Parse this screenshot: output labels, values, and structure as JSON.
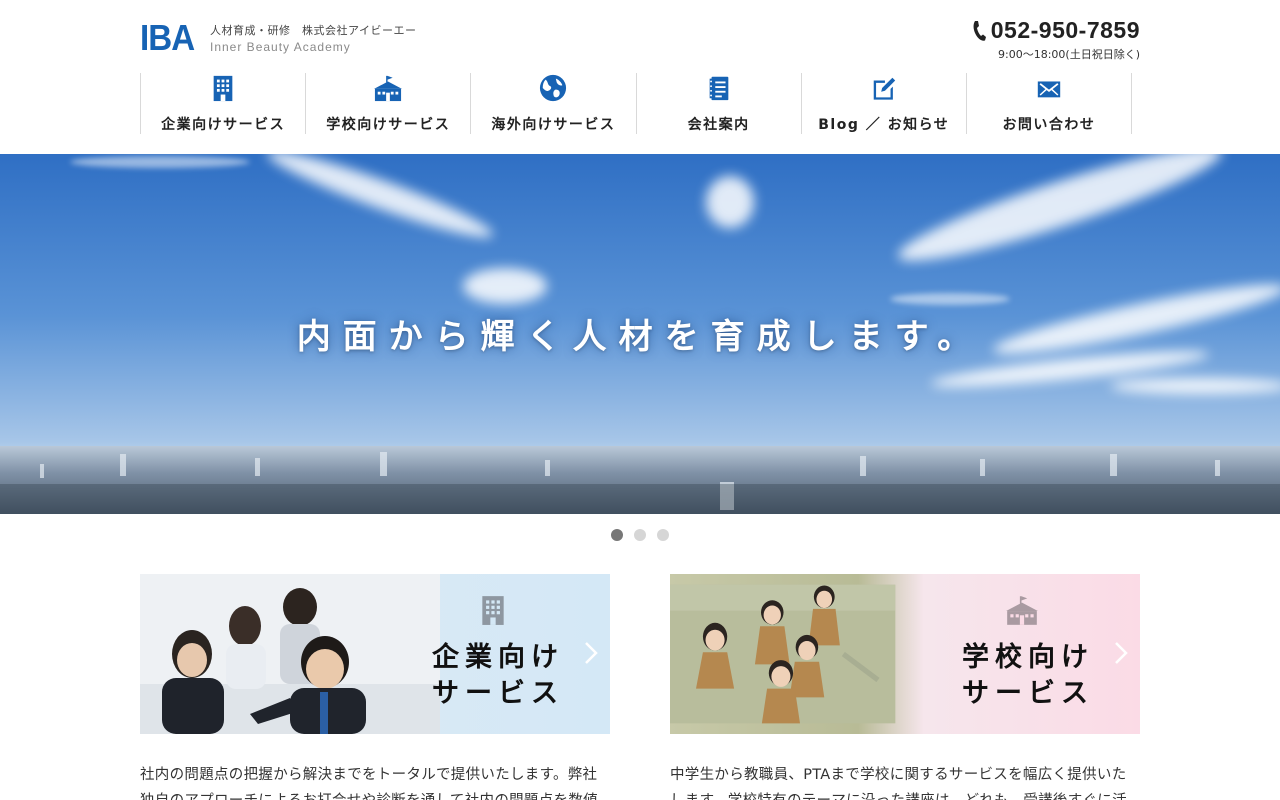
{
  "header": {
    "logo": "IBA",
    "tagline": "人材育成・研修　株式会社アイビーエー",
    "subname": "Inner Beauty Academy",
    "phone_icon": "phone-icon",
    "phone": "052-950-7859",
    "hours": "9:00〜18:00(土日祝日除く)"
  },
  "nav": {
    "items": [
      {
        "label": "企業向けサービス",
        "icon": "building-icon"
      },
      {
        "label": "学校向けサービス",
        "icon": "school-icon"
      },
      {
        "label": "海外向けサービス",
        "icon": "globe-icon"
      },
      {
        "label": "会社案内",
        "icon": "document-icon"
      },
      {
        "label": "Blog ／ お知らせ",
        "icon": "edit-icon"
      },
      {
        "label": "お問い合わせ",
        "icon": "mail-icon"
      }
    ]
  },
  "hero": {
    "copy": "内面から輝く人材を育成します。"
  },
  "slider": {
    "count": 3,
    "active": 1
  },
  "cards": {
    "corporate": {
      "title_line1": "企業向け",
      "title_line2": "サービス",
      "icon": "building-icon",
      "description": "社内の問題点の把握から解決までをトータルで提供いたします。弊社独自のアプローチによるお打合せや診断を通して社内の問題点を数値"
    },
    "school": {
      "title_line1": "学校向け",
      "title_line2": "サービス",
      "icon": "school-icon",
      "description": "中学生から教職員、PTAまで学校に関するサービスを幅広く提供いたします。学校特有のテーマに沿った講座は、どれも、受講後すぐに活"
    }
  },
  "colors": {
    "brand": "#1763b4",
    "nav_border": "#d9d9d9",
    "corp_panel": "#d4e8f6",
    "school_panel": "#fbdbe6"
  }
}
